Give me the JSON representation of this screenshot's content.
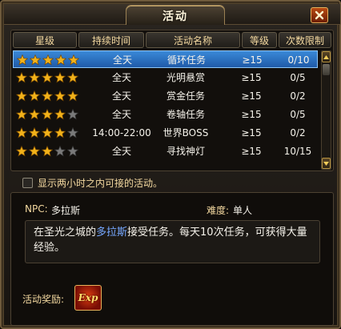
{
  "window": {
    "title": "活动"
  },
  "table": {
    "headers": [
      "星级",
      "持续时间",
      "活动名称",
      "等级",
      "次数限制"
    ],
    "rows": [
      {
        "stars": 5,
        "time": "全天",
        "name": "循环任务",
        "level": "≥15",
        "limit": "0/10",
        "selected": true
      },
      {
        "stars": 5,
        "time": "全天",
        "name": "光明悬赏",
        "level": "≥15",
        "limit": "0/5",
        "selected": false
      },
      {
        "stars": 5,
        "time": "全天",
        "name": "赏金任务",
        "level": "≥15",
        "limit": "0/2",
        "selected": false
      },
      {
        "stars": 4,
        "time": "全天",
        "name": "卷轴任务",
        "level": "≥15",
        "limit": "0/5",
        "selected": false
      },
      {
        "stars": 4,
        "time": "14:00-22:00",
        "name": "世界BOSS",
        "level": "≥15",
        "limit": "0/2",
        "selected": false
      },
      {
        "stars": 3,
        "time": "全天",
        "name": "寻找神灯",
        "level": "≥15",
        "limit": "10/15",
        "selected": false
      }
    ],
    "max_stars": 5
  },
  "filter": {
    "label": "显示两小时之内可接的活动。",
    "checked": false
  },
  "detail": {
    "npc_label": "NPC:",
    "npc_value": "多拉斯",
    "difficulty_label": "难度:",
    "difficulty_value": "单人",
    "desc_before": "在圣光之城的",
    "desc_link": "多拉斯",
    "desc_after": "接受任务。每天10次任务，可获得大量经验。",
    "reward_label": "活动奖励:",
    "reward_icon_text": "Exp"
  },
  "colors": {
    "accent_text": "#f4d9a0",
    "selected_row": "#2f74c6",
    "star_gold": "#f2b21a",
    "star_empty": "#7a7a7a",
    "link": "#76a8ff"
  }
}
